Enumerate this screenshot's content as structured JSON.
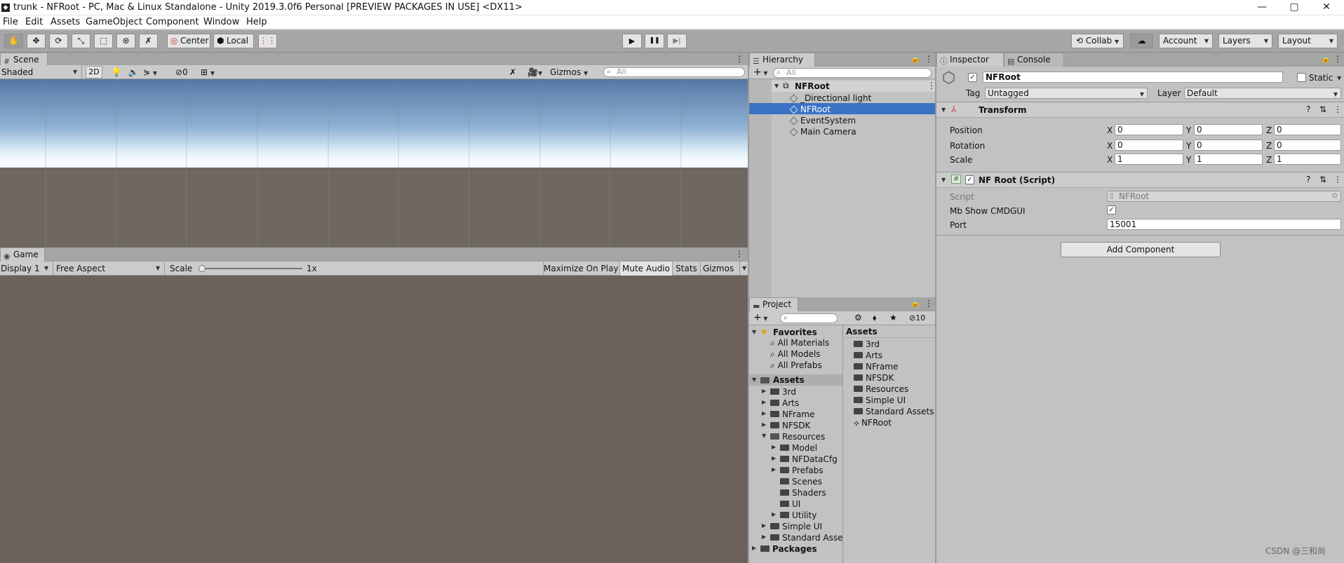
{
  "window": {
    "title": "trunk - NFRoot - PC, Mac & Linux Standalone - Unity 2019.3.0f6 Personal [PREVIEW PACKAGES IN USE] <DX11>",
    "app_icon": "unity-icon",
    "controls": {
      "minimize": "—",
      "maximize": "▢",
      "close": "✕"
    }
  },
  "menu": {
    "items": [
      "File",
      "Edit",
      "Assets",
      "GameObject",
      "Component",
      "Window",
      "Help"
    ]
  },
  "toolbar": {
    "tools": [
      "hand-tool",
      "move-tool",
      "rotate-tool",
      "scale-tool",
      "rect-tool",
      "transform-tool",
      "custom-tool"
    ],
    "pivot": "Center",
    "space": "Local",
    "snap": "snap-icon",
    "play": "▶",
    "pause": "❚❚",
    "step": "▶|",
    "collab": "Collab",
    "cloud": "cloud-icon",
    "account": "Account",
    "layers": "Layers",
    "layout": "Layout"
  },
  "scene": {
    "tab": "Scene",
    "shading": "Shaded",
    "mode_2d": "2D",
    "hidden_count": "0",
    "gizmos": "Gizmos",
    "search_placeholder": "All"
  },
  "game": {
    "tab": "Game",
    "display": "Display 1",
    "aspect": "Free Aspect",
    "scale_label": "Scale",
    "scale_value": "1x",
    "scale_fraction": 0.0,
    "maximize": "Maximize On Play",
    "mute": "Mute Audio",
    "stats": "Stats",
    "gizmos": "Gizmos"
  },
  "hierarchy": {
    "tab": "Hierarchy",
    "search_placeholder": "All",
    "scene": "NFRoot",
    "items": [
      "_Directional light",
      "NFRoot",
      "EventSystem",
      "Main Camera"
    ],
    "selected": "NFRoot"
  },
  "project": {
    "tab": "Project",
    "hidden_count": "10",
    "favorites": {
      "label": "Favorites",
      "items": [
        "All Materials",
        "All Models",
        "All Prefabs"
      ]
    },
    "assets_label": "Assets",
    "tree": [
      "3rd",
      "Arts",
      "NFrame",
      "NFSDK",
      "Resources"
    ],
    "resources_children": [
      "Model",
      "NFDataCfg",
      "Prefabs",
      "Scenes",
      "Shaders",
      "UI",
      "Utility"
    ],
    "tree_after": [
      "Simple UI",
      "Standard Asset"
    ],
    "packages": "Packages",
    "content_header": "Assets",
    "content": [
      "3rd",
      "Arts",
      "NFrame",
      "NFSDK",
      "Resources",
      "Simple UI",
      "Standard Assets",
      "NFRoot"
    ]
  },
  "inspector": {
    "tab": "Inspector",
    "console_tab": "Console",
    "object_name": "NFRoot",
    "static_label": "Static",
    "tag_label": "Tag",
    "tag_value": "Untagged",
    "layer_label": "Layer",
    "layer_value": "Default",
    "transform": {
      "title": "Transform",
      "rows": [
        {
          "label": "Position",
          "x": "0",
          "y": "0",
          "z": "0"
        },
        {
          "label": "Rotation",
          "x": "0",
          "y": "0",
          "z": "0"
        },
        {
          "label": "Scale",
          "x": "1",
          "y": "1",
          "z": "1"
        }
      ]
    },
    "script_component": {
      "title": "NF Root (Script)",
      "script_label": "Script",
      "script_value": "NFRoot",
      "mb_label": "Mb Show CMDGUI",
      "mb_checked": true,
      "port_label": "Port",
      "port_value": "15001"
    },
    "add_component": "Add Component"
  },
  "watermark": "CSDN @三和尚",
  "colors": {
    "selection": "#3a72c4",
    "scene_sky_top": "#5a7aa8",
    "scene_horizon": "#e8f4fb",
    "scene_ground": "#6f6862",
    "game_bg": "#6c625b",
    "pivot_icon": "#c0392b"
  }
}
